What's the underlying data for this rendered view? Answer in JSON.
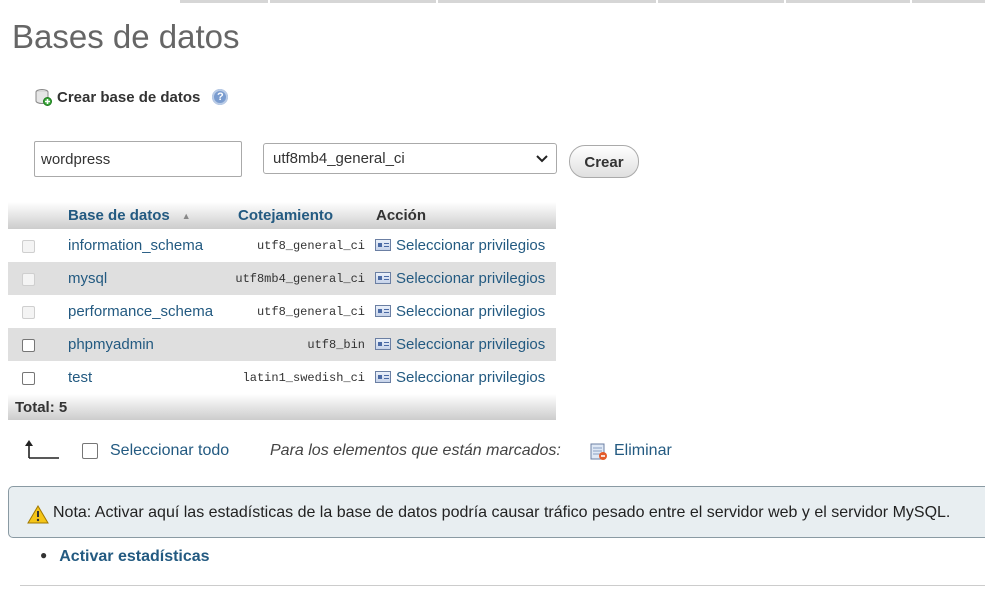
{
  "page": {
    "title": "Bases de datos"
  },
  "create": {
    "heading": "Crear base de datos",
    "name_value": "wordpress",
    "collation_selected": "utf8mb4_general_ci",
    "button_label": "Crear"
  },
  "table": {
    "columns": {
      "name": "Base de datos",
      "collation": "Cotejamiento",
      "action": "Acción"
    },
    "rows": [
      {
        "name": "information_schema",
        "collation": "utf8_general_ci",
        "action": "Seleccionar privilegios",
        "checkbox_enabled": false
      },
      {
        "name": "mysql",
        "collation": "utf8mb4_general_ci",
        "action": "Seleccionar privilegios",
        "checkbox_enabled": false
      },
      {
        "name": "performance_schema",
        "collation": "utf8_general_ci",
        "action": "Seleccionar privilegios",
        "checkbox_enabled": false
      },
      {
        "name": "phpmyadmin",
        "collation": "utf8_bin",
        "action": "Seleccionar privilegios",
        "checkbox_enabled": true
      },
      {
        "name": "test",
        "collation": "latin1_swedish_ci",
        "action": "Seleccionar privilegios",
        "checkbox_enabled": true
      }
    ],
    "total_label": "Total: 5"
  },
  "bulk": {
    "select_all_label": "Seleccionar todo",
    "marked_label": "Para los elementos que están marcados:",
    "delete_label": "Eliminar"
  },
  "notice": {
    "text": "Nota: Activar aquí las estadísticas de la base de datos podría causar tráfico pesado entre el servidor web y el servidor MySQL."
  },
  "stats_link": {
    "label": "Activar estadísticas"
  },
  "colors": {
    "link": "#235a81",
    "notice_bg": "#e8eef1",
    "row_alt": "#dfdfdf"
  },
  "icons": [
    "database-add-icon",
    "help-icon",
    "chevron-down-icon",
    "privileges-icon",
    "arrow-up-left-icon",
    "delete-icon",
    "warning-icon"
  ]
}
